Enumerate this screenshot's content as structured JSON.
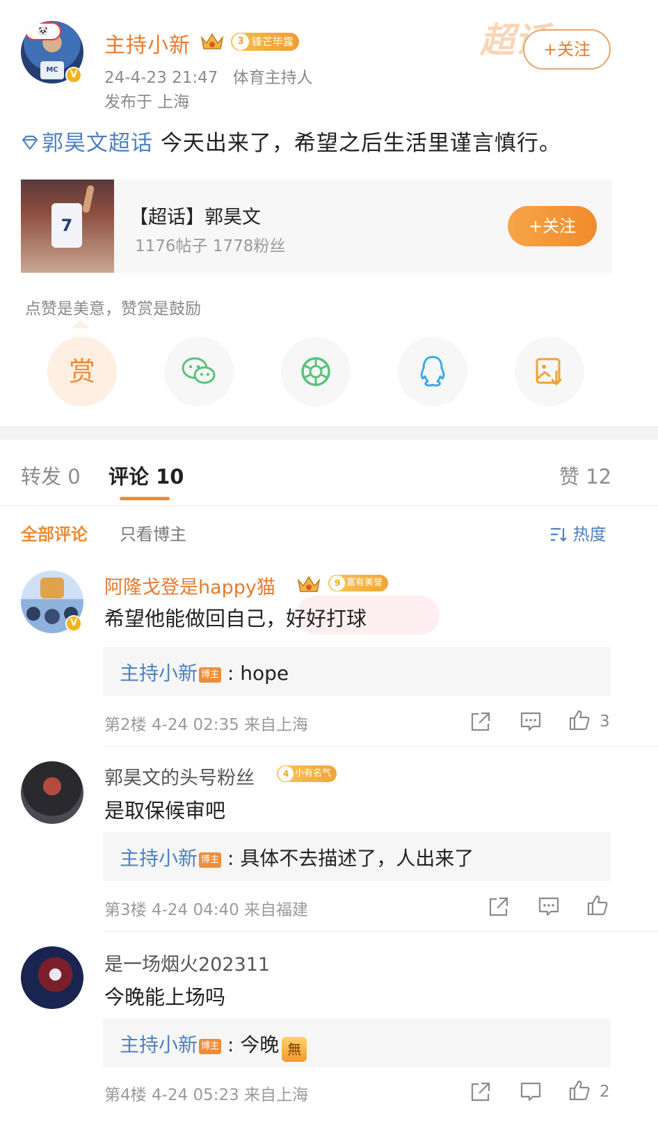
{
  "post": {
    "author": "主持小新",
    "level": "3",
    "level_title": "锋芒毕露",
    "time": "24-4-23 21:47",
    "role": "体育主持人",
    "location": "发布于 上海",
    "follow": "+关注",
    "watermark": "超话",
    "topic": "郭昊文超话",
    "text": " 今天出来了，希望之后生活里谨言慎行。"
  },
  "topic_card": {
    "title": "【超话】郭昊文",
    "stats": "1176帖子 1778粉丝",
    "follow": "+关注",
    "jersey_number": "7"
  },
  "reward_tip": "点赞是美意，赞赏是鼓励",
  "share": {
    "reward": "赏",
    "icons": [
      "wechat-icon",
      "moments-icon",
      "qq-icon",
      "save-image-icon"
    ]
  },
  "tabs": {
    "repost": "转发 0",
    "comments": "评论 10",
    "likes": "赞 12"
  },
  "filters": {
    "all": "全部评论",
    "owner_only": "只看博主",
    "sort": "热度"
  },
  "host_tag": "博主",
  "comments": [
    {
      "name": "阿隆戈登是happy猫",
      "level": "9",
      "level_title": "富有美誉",
      "text": "希望他能做回自己，好好打球",
      "reply_author": "主持小新",
      "reply": "hope",
      "meta": "第2楼 4-24 02:35 来自上海",
      "likes": "3"
    },
    {
      "name": "郭昊文的头号粉丝",
      "level": "4",
      "level_title": "小有名气",
      "text": "是取保候审吧",
      "reply_author": "主持小新",
      "reply": "具体不去描述了，人出来了",
      "meta": "第3楼 4-24 04:40 来自福建",
      "likes": ""
    },
    {
      "name": "是一场烟火202311",
      "text": "今晚能上场吗",
      "reply_author": "主持小新",
      "reply": "今晚",
      "reply_emoji": "無",
      "meta": "第4楼 4-24 05:23 来自上海",
      "likes": "2"
    }
  ],
  "colors": {
    "accent_orange": "#ef8b31",
    "link_blue": "#4f7fc2",
    "verified_gold": "#f5b21a"
  }
}
